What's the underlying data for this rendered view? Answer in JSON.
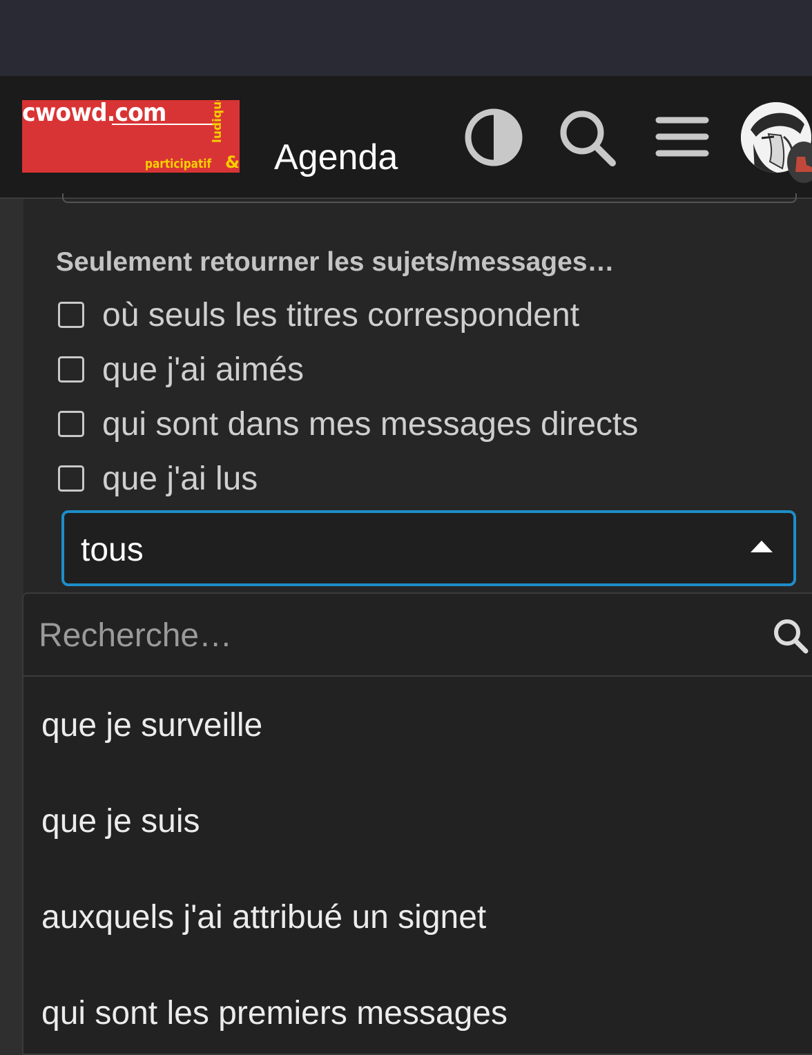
{
  "header": {
    "logo_main": "cwowd.com",
    "logo_sub": "participatif",
    "logo_amp": "&",
    "logo_vertical": "ludique",
    "title": "Agenda",
    "icons": [
      "theme-toggle-icon",
      "search-icon",
      "menu-icon",
      "avatar"
    ]
  },
  "filters": {
    "label": "Seulement retourner les sujets/messages…",
    "checkboxes": [
      {
        "label": "où seuls les titres correspondent",
        "checked": false
      },
      {
        "label": "que j'ai aimés",
        "checked": false
      },
      {
        "label": "qui sont dans mes messages directs",
        "checked": false
      },
      {
        "label": "que j'ai lus",
        "checked": false
      }
    ],
    "select": {
      "value": "tous",
      "expanded": true
    }
  },
  "dropdown": {
    "search_placeholder": "Recherche…",
    "options": [
      "que je surveille",
      "que je suis",
      "auxquels j'ai attribué un signet",
      "qui sont les premiers messages"
    ]
  },
  "colors": {
    "accent": "#1d8ec8",
    "logo_red": "#d93435",
    "logo_yellow": "#f5d000",
    "header_bg": "#1b1b1b",
    "content_bg": "#262626"
  }
}
